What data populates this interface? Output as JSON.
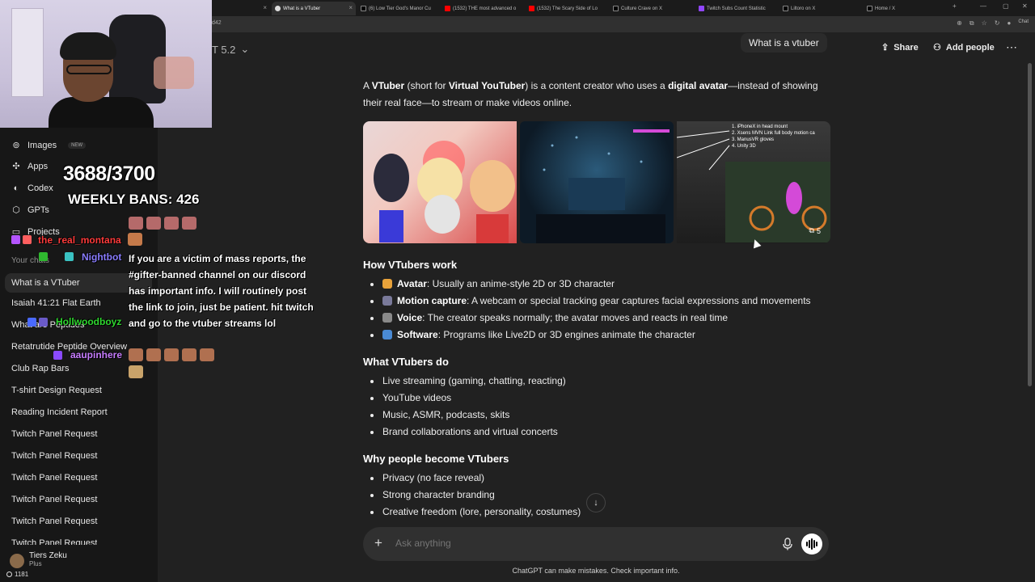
{
  "browser": {
    "tabs": [
      {
        "label": "",
        "color": "#444444"
      },
      {
        "label": "What is a VTuber",
        "color": "#ffffff"
      },
      {
        "label": "(6) Low Tier God's Manor Cu",
        "color": "#000000"
      },
      {
        "label": "(1532) THE most advanced o",
        "color": "#ff0000"
      },
      {
        "label": "(1532) The Scary Side of Lo",
        "color": "#ff0000"
      },
      {
        "label": "Culture Crave on X",
        "color": "#000000"
      },
      {
        "label": "Twitch Subs Count Statistic",
        "color": "#9146ff"
      },
      {
        "label": "Liltoro on X",
        "color": "#000000"
      },
      {
        "label": "Home / X",
        "color": "#000000"
      }
    ],
    "address_suffix": "d42",
    "chat_label": "Chat"
  },
  "sidebar": {
    "nav": [
      {
        "label": "Images",
        "icon": "images-icon",
        "badge": "NEW"
      },
      {
        "label": "Apps",
        "icon": "apps-icon"
      },
      {
        "label": "Codex",
        "icon": "codex-icon"
      },
      {
        "label": "GPTs",
        "icon": "gpts-icon"
      },
      {
        "label": "Projects",
        "icon": "folder-icon"
      }
    ],
    "chats_header": "Your chats",
    "chats": [
      "What is a VTuber",
      "Isaiah 41:21 Flat Earth",
      "What are Peptides",
      "Retatrutide Peptide Overview",
      "Club Rap Bars",
      "T-shirt Design Request",
      "Reading Incident Report",
      "Twitch Panel Request",
      "Twitch Panel Request",
      "Twitch Panel Request",
      "Twitch Panel Request",
      "Twitch Panel Request",
      "Twitch Panel Request"
    ],
    "user": {
      "name": "Tiers Zeku",
      "plan": "Plus"
    },
    "viewer_count": "1181"
  },
  "overlay": {
    "sub_count": "3688/3700",
    "weekly_bans": "WEEKLY BANS: 426",
    "chat": [
      {
        "user": "the_real_montana",
        "color": "#ff3b3b"
      },
      {
        "user": "Nightbot",
        "color": "#8a7dff"
      },
      {
        "user": "Hollwoodboyz",
        "color": "#2fd82f"
      },
      {
        "user": "aaupinhere",
        "color": "#c77dff"
      }
    ],
    "message": "If you are a victim of mass reports, the #gifter-banned channel on our discord has important info. I will routinely post the link to join, just be patient. hit twitch and go to the vtuber streams lol"
  },
  "header": {
    "model": "T 5.2",
    "chat_title": "What is a vtuber",
    "share": "Share",
    "add_people": "Add people"
  },
  "content": {
    "intro_parts": [
      "A ",
      "VTuber",
      " (short for ",
      "Virtual YouTuber",
      ") is a content creator who uses a ",
      "digital avatar",
      "—instead of showing their real face—to stream or make videos online."
    ],
    "image_count": "5",
    "image3_labels": [
      "1. iPhoneX in head mount",
      "2. Xsens MVN Link full body motion ca",
      "3. ManusVR gloves",
      "4. Unity 3D"
    ],
    "sections": [
      {
        "title": "How VTubers work",
        "items": [
          {
            "bold": "Avatar",
            "text": ": Usually an anime-style 2D or 3D character",
            "emoji_color": "#e8a23a"
          },
          {
            "bold": "Motion capture",
            "text": ": A webcam or special tracking gear captures facial expressions and movements",
            "emoji_color": "#7a7a9a"
          },
          {
            "bold": "Voice",
            "text": ": The creator speaks normally; the avatar moves and reacts in real time",
            "emoji_color": "#8a8a8a"
          },
          {
            "bold": "Software",
            "text": ": Programs like Live2D or 3D engines animate the character",
            "emoji_color": "#4a8ad4"
          }
        ]
      },
      {
        "title": "What VTubers do",
        "items": [
          {
            "text": "Live streaming (gaming, chatting, reacting)"
          },
          {
            "text": "YouTube videos"
          },
          {
            "text": "Music, ASMR, podcasts, skits"
          },
          {
            "text": "Brand collaborations and virtual concerts"
          }
        ]
      },
      {
        "title": "Why people become VTubers",
        "items": [
          {
            "text": "Privacy (no face reveal)"
          },
          {
            "text": "Strong character branding"
          },
          {
            "text": "Creative freedom (lore, personality, costumes)"
          }
        ]
      }
    ]
  },
  "composer": {
    "placeholder": "Ask anything",
    "disclaimer": "ChatGPT can make mistakes. Check important info."
  }
}
